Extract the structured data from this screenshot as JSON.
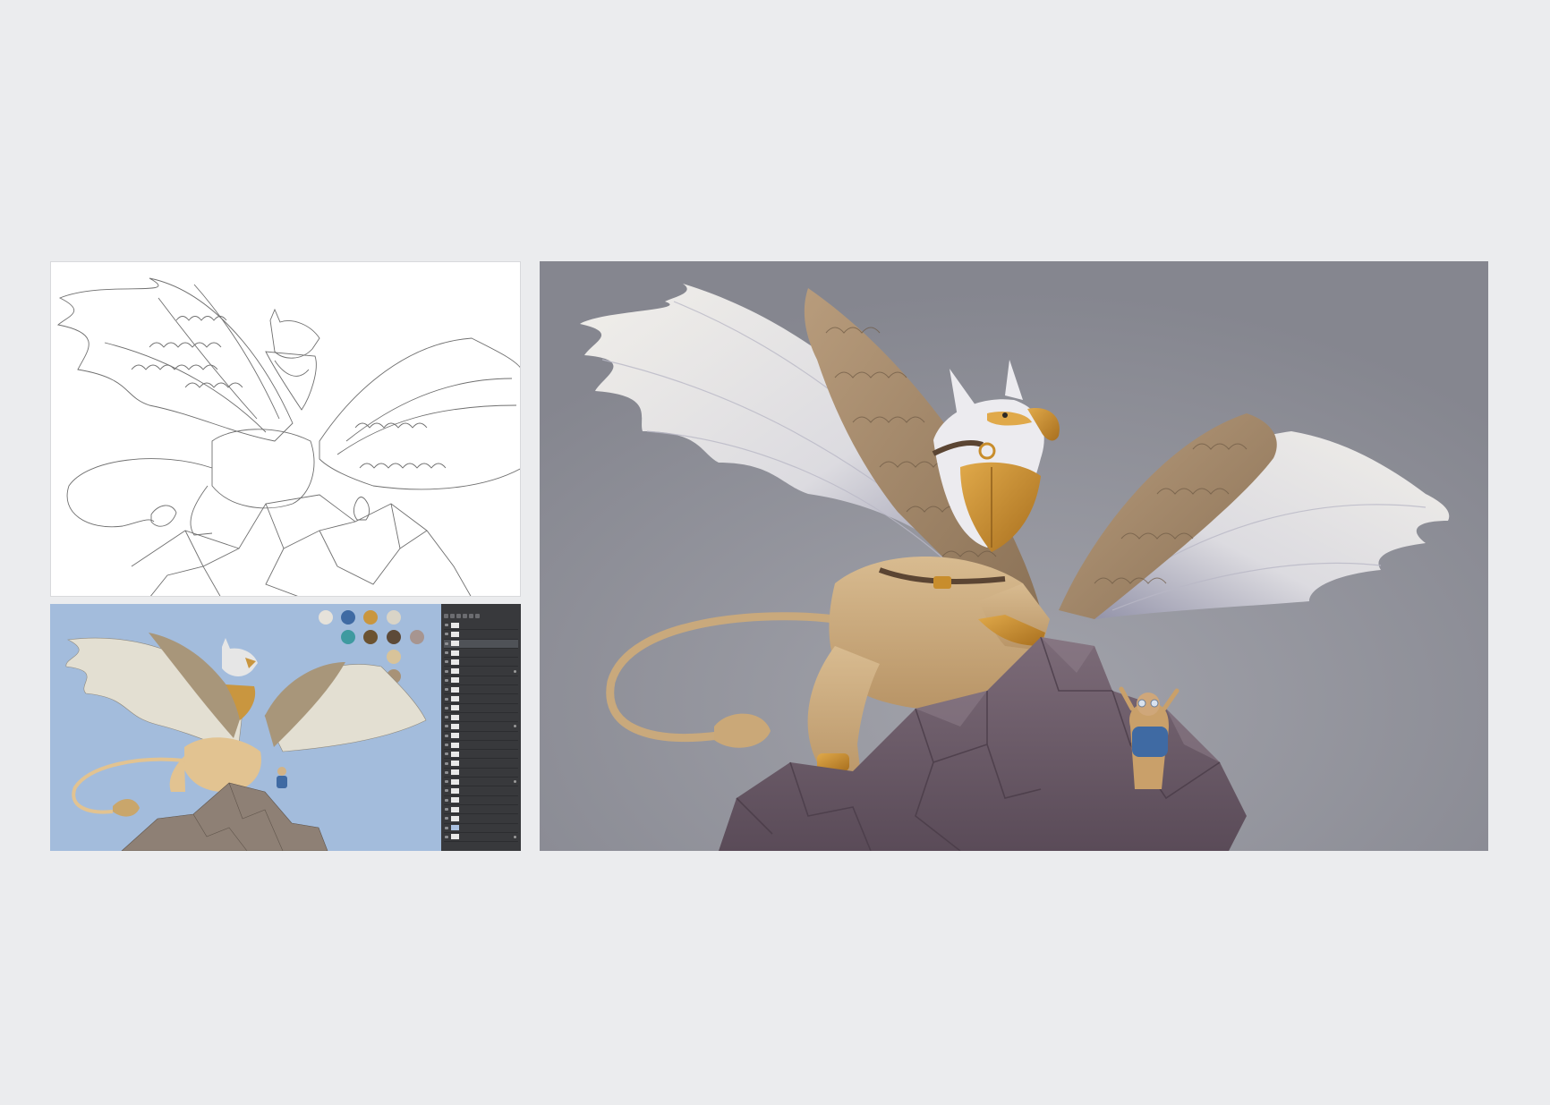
{
  "palette": [
    "#e6e2da",
    "#3f6aa3",
    "#c9963f",
    "#d9d4c7",
    "#3f9aa0",
    "#6b5231",
    "#5d4a38",
    "#d8c39a",
    "#a89277",
    "#a79590"
  ],
  "colors": {
    "page_bg": "#ebecee",
    "final_bg": "#8a8b94",
    "flat_bg": "#a3bcdc",
    "rock": "#74646f",
    "fur": "#d2b387",
    "wing_brown": "#a58a6c",
    "wing_white": "#ececf0",
    "armor_gold": "#c88d2c"
  },
  "icons": [
    "eye-icon",
    "lock-icon",
    "layer-thumbnail"
  ]
}
